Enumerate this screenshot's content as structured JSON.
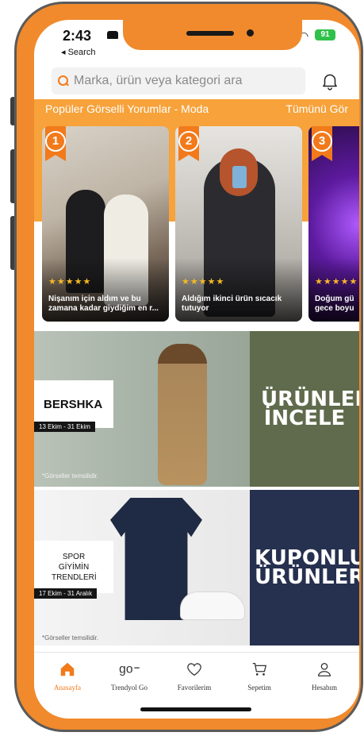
{
  "status": {
    "time": "2:43",
    "back_label": "◂ Search",
    "battery": "91"
  },
  "search": {
    "placeholder": "Marka, ürün veya kategori ara"
  },
  "popular": {
    "title": "Popüler Görselli Yorumlar - Moda",
    "see_all": "Tümünü Gör",
    "cards": [
      {
        "rank": "1",
        "stars": "★★★★★",
        "caption": "Nişanım için aldım ve bu zamana kadar giydiğim en r..."
      },
      {
        "rank": "2",
        "stars": "★★★★★",
        "caption": "Aldığım ikinci ürün sıcacık tutuyor"
      },
      {
        "rank": "3",
        "stars": "★★★★★",
        "caption": "Doğum gü gece boyu"
      }
    ]
  },
  "banners": [
    {
      "brand": "BERSHKA",
      "dates": "13 Ekim - 31 Ekim",
      "disclaimer": "*Görseller temsilidir.",
      "cta": "ÜRÜNLERİ İNCELE"
    },
    {
      "brand": "SPOR GİYİMİN TRENDLERİ",
      "dates": "17 Ekim - 31 Aralık",
      "disclaimer": "*Görseller temsilidir.",
      "cta": "KUPONLU ÜRÜNLER"
    }
  ],
  "nav": {
    "items": [
      {
        "label": "Anasayfa",
        "icon": "home-icon",
        "active": true
      },
      {
        "label": "Trendyol Go",
        "icon": "go-icon",
        "active": false
      },
      {
        "label": "Favorilerim",
        "icon": "heart-icon",
        "active": false
      },
      {
        "label": "Sepetim",
        "icon": "cart-icon",
        "active": false
      },
      {
        "label": "Hesabım",
        "icon": "user-icon",
        "active": false
      }
    ]
  },
  "colors": {
    "brand": "#f27a1a",
    "frame": "#f08a2c",
    "banner1_right": "#5f6b4c",
    "banner2_right": "#26304f"
  }
}
